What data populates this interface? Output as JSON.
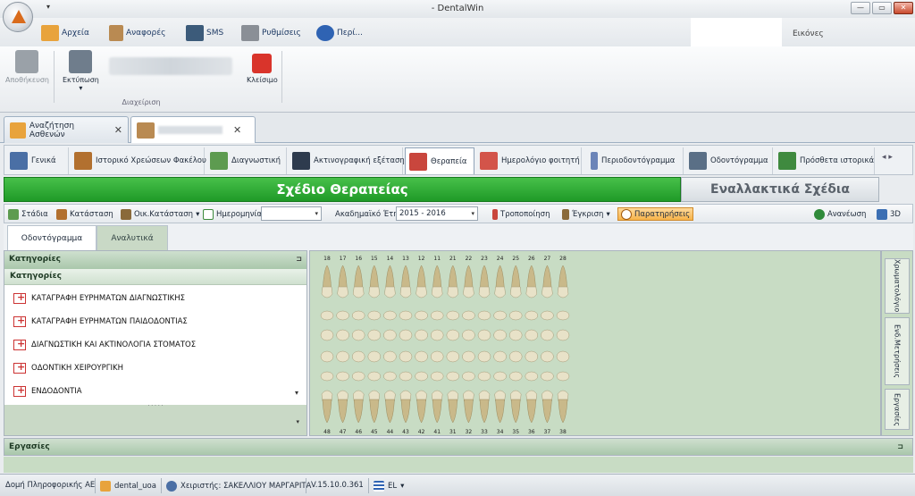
{
  "window": {
    "title": "- DentalWin",
    "qat_arrow": "▾",
    "minimize": "—",
    "restore": "▭",
    "close": "✕"
  },
  "menu": [
    {
      "label": "Αρχεία",
      "icon": "folder-icon",
      "color": "#e8a33c"
    },
    {
      "label": "Αναφορές",
      "icon": "clipboard-icon",
      "color": "#b98a52"
    },
    {
      "label": "SMS",
      "icon": "phone-icon",
      "color": "#3c5b7a"
    },
    {
      "label": "Ρυθμίσεις",
      "icon": "tools-icon",
      "color": "#8a8f96"
    },
    {
      "label": "Περί...",
      "icon": "info-icon",
      "color": "#2f63b3"
    }
  ],
  "images_tab": "Εικόνες",
  "ribbon": {
    "save": "Αποθήκευση",
    "print": "Εκτύπωση",
    "print_arrow": "▾",
    "close": "Κλείσιμο",
    "group_label": "Διαχείριση"
  },
  "doc_tabs": [
    {
      "label": "Αναζήτηση Ασθενών",
      "close": "✕"
    },
    {
      "label": "",
      "close": "✕"
    }
  ],
  "module_tabs": [
    {
      "label": "Γενικά",
      "color": "#4a6fa5"
    },
    {
      "label": "Ιστορικό Χρεώσεων Φακέλου",
      "color": "#b2702f"
    },
    {
      "label": "Διαγνωστική",
      "color": "#5d9b50"
    },
    {
      "label": "Ακτινογραφική εξέταση",
      "color": "#2e3b4e"
    },
    {
      "label": "Θεραπεία",
      "color": "#c9463d",
      "active": true
    },
    {
      "label": "Ημερολόγιο φοιτητή",
      "color": "#d3544a"
    },
    {
      "label": "Περιοδοντόγραμμα",
      "color": "#6b84b8"
    },
    {
      "label": "Οδοντόγραμμα",
      "color": "#5a6f86"
    },
    {
      "label": "Πρόσθετα ιστορικά",
      "color": "#3f8a3f"
    }
  ],
  "tab_arrows": "◂  ▸",
  "headers": {
    "plan": "Σχέδιο Θεραπείας",
    "alt": "Εναλλακτικά Σχέδια"
  },
  "toolbar": {
    "stages": "Στάδια",
    "status": "Κατάσταση",
    "fin_status": "Οικ.Κατάσταση",
    "date": "Ημερομηνία",
    "date_value": "",
    "academic_year": "Ακαδημαϊκό Έτη",
    "year_value": "2015 - 2016",
    "modification": "Τροποποίηση",
    "approval": "Έγκριση",
    "remarks": "Παρατηρήσεις",
    "refresh": "Ανανέωση",
    "view3d": "3D",
    "dd_arrow": "▾"
  },
  "subtabs": {
    "odontogram": "Οδοντόγραμμα",
    "analytics": "Αναλυτικά"
  },
  "categories_panel": {
    "header": "Κατηγορίες",
    "pin": "⊐",
    "subheader": "Κατηγορίες",
    "items": [
      "ΚΑΤΑΓΡΑΦΗ ΕΥΡΗΜΑΤΩΝ ΔΙΑΓΝΩΣΤΙΚΗΣ",
      "ΚΑΤΑΓΡΑΦΗ ΕΥΡΗΜΑΤΩΝ ΠΑΙΔΟΔΟΝΤΙΑΣ",
      "ΔΙΑΓΝΩΣΤΙΚΗ ΚΑΙ ΑΚΤΙΝΟΛΟΓΙΑ ΣΤΟΜΑΤΟΣ",
      "ΟΔΟΝΤΙΚΗ ΧΕΙΡΟΥΡΓΙΚΗ",
      "ΕΝΔΟΔΟΝΤΙΑ"
    ],
    "scroll_down": "▾",
    "splitter": "· · · · ·",
    "lower_arrow": "▾"
  },
  "tooth_chart": {
    "upper_numbers": [
      "18",
      "17",
      "16",
      "15",
      "14",
      "13",
      "12",
      "11",
      "21",
      "22",
      "23",
      "24",
      "25",
      "26",
      "27",
      "28"
    ],
    "lower_numbers": [
      "48",
      "47",
      "46",
      "45",
      "44",
      "43",
      "42",
      "41",
      "31",
      "32",
      "33",
      "34",
      "35",
      "36",
      "37",
      "38"
    ],
    "tooth_color": "#e8e2c8",
    "root_color": "#c9b98a"
  },
  "side_tabs": [
    "Χρωματολόγιο",
    "Ενδ.Μετρήσεις",
    "Εργασίες"
  ],
  "tasks_panel": {
    "label": "Εργασίες",
    "pin": "⊐"
  },
  "status_bar": {
    "company": "Δομή Πληροφορικής ΑΕ",
    "db": "dental_uoa",
    "user": "Χειριστής: ΣΑΚΕΛΛΙΟΥ ΜΑΡΓΑΡΙΤΑ",
    "version": "V.15.10.0.361",
    "lang": "EL",
    "lang_arrow": "▾"
  }
}
